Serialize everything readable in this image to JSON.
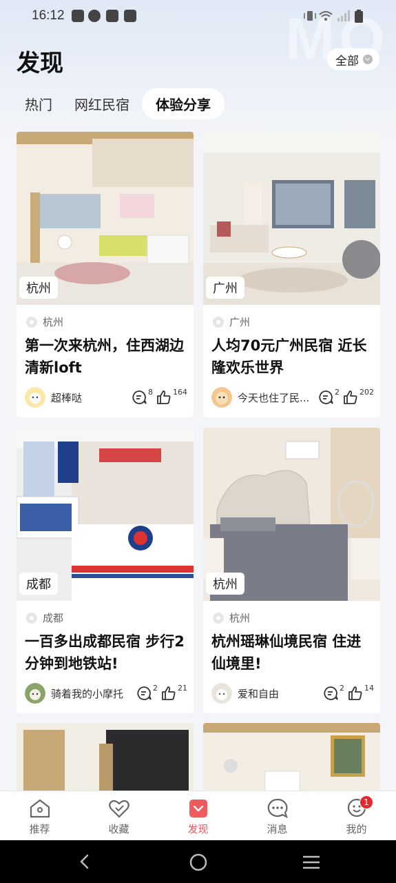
{
  "status_bar": {
    "time": "16:12"
  },
  "header": {
    "title": "发现",
    "filter_label": "全部"
  },
  "tabs": [
    {
      "label": "热门",
      "active": false
    },
    {
      "label": "网红民宿",
      "active": false
    },
    {
      "label": "体验分享",
      "active": true
    }
  ],
  "cards": [
    {
      "city_tag": "杭州",
      "location": "杭州",
      "title": "第一次来杭州，住西湖边清新loft",
      "author": "超棒哒",
      "comments": "8",
      "likes": "164"
    },
    {
      "city_tag": "广州",
      "location": "广州",
      "title": "人均70元广州民宿 近长隆欢乐世界",
      "author": "今天也住了民...",
      "comments": "2",
      "likes": "202"
    },
    {
      "city_tag": "成都",
      "location": "成都",
      "title": "一百多出成都民宿 步行2分钟到地铁站!",
      "author": "骑着我的小摩托",
      "comments": "2",
      "likes": "21"
    },
    {
      "city_tag": "杭州",
      "location": "杭州",
      "title": "杭州瑶琳仙境民宿 住进仙境里!",
      "author": "爱和自由",
      "comments": "2",
      "likes": "14"
    }
  ],
  "bottom_nav": [
    {
      "label": "推荐",
      "icon": "home-icon",
      "active": false
    },
    {
      "label": "收藏",
      "icon": "heart-check-icon",
      "active": false
    },
    {
      "label": "发现",
      "icon": "discover-icon",
      "active": true
    },
    {
      "label": "消息",
      "icon": "message-icon",
      "active": false
    },
    {
      "label": "我的",
      "icon": "profile-icon",
      "active": false,
      "badge": "1"
    }
  ],
  "colors": {
    "accent": "#ef5a5f",
    "badge": "#e8262e"
  }
}
